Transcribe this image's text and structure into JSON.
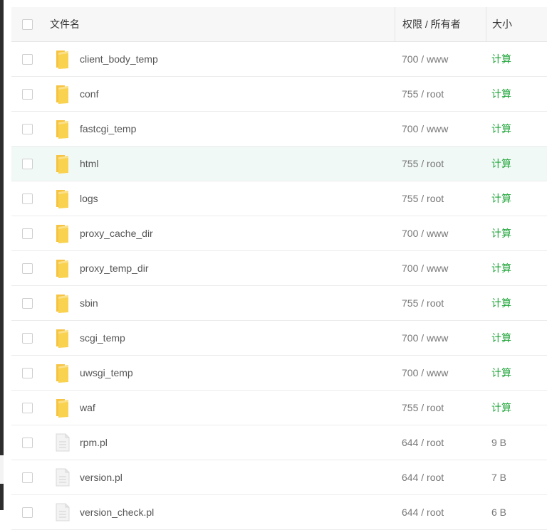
{
  "header": {
    "name": "文件名",
    "permission": "权限 / 所有者",
    "size": "大小"
  },
  "colors": {
    "calc_link": "#20a53a",
    "folder": "#f6c342",
    "hover_row": "#f1f9f6"
  },
  "rows": [
    {
      "name": "client_body_temp",
      "perm": "700 / www",
      "size": "计算",
      "type": "folder"
    },
    {
      "name": "conf",
      "perm": "755 / root",
      "size": "计算",
      "type": "folder"
    },
    {
      "name": "fastcgi_temp",
      "perm": "700 / www",
      "size": "计算",
      "type": "folder"
    },
    {
      "name": "html",
      "perm": "755 / root",
      "size": "计算",
      "type": "folder"
    },
    {
      "name": "logs",
      "perm": "755 / root",
      "size": "计算",
      "type": "folder"
    },
    {
      "name": "proxy_cache_dir",
      "perm": "700 / www",
      "size": "计算",
      "type": "folder"
    },
    {
      "name": "proxy_temp_dir",
      "perm": "700 / www",
      "size": "计算",
      "type": "folder"
    },
    {
      "name": "sbin",
      "perm": "755 / root",
      "size": "计算",
      "type": "folder"
    },
    {
      "name": "scgi_temp",
      "perm": "700 / www",
      "size": "计算",
      "type": "folder"
    },
    {
      "name": "uwsgi_temp",
      "perm": "700 / www",
      "size": "计算",
      "type": "folder"
    },
    {
      "name": "waf",
      "perm": "755 / root",
      "size": "计算",
      "type": "folder"
    },
    {
      "name": "rpm.pl",
      "perm": "644 / root",
      "size": "9 B",
      "type": "file"
    },
    {
      "name": "version.pl",
      "perm": "644 / root",
      "size": "7 B",
      "type": "file"
    },
    {
      "name": "version_check.pl",
      "perm": "644 / root",
      "size": "6 B",
      "type": "file"
    }
  ]
}
